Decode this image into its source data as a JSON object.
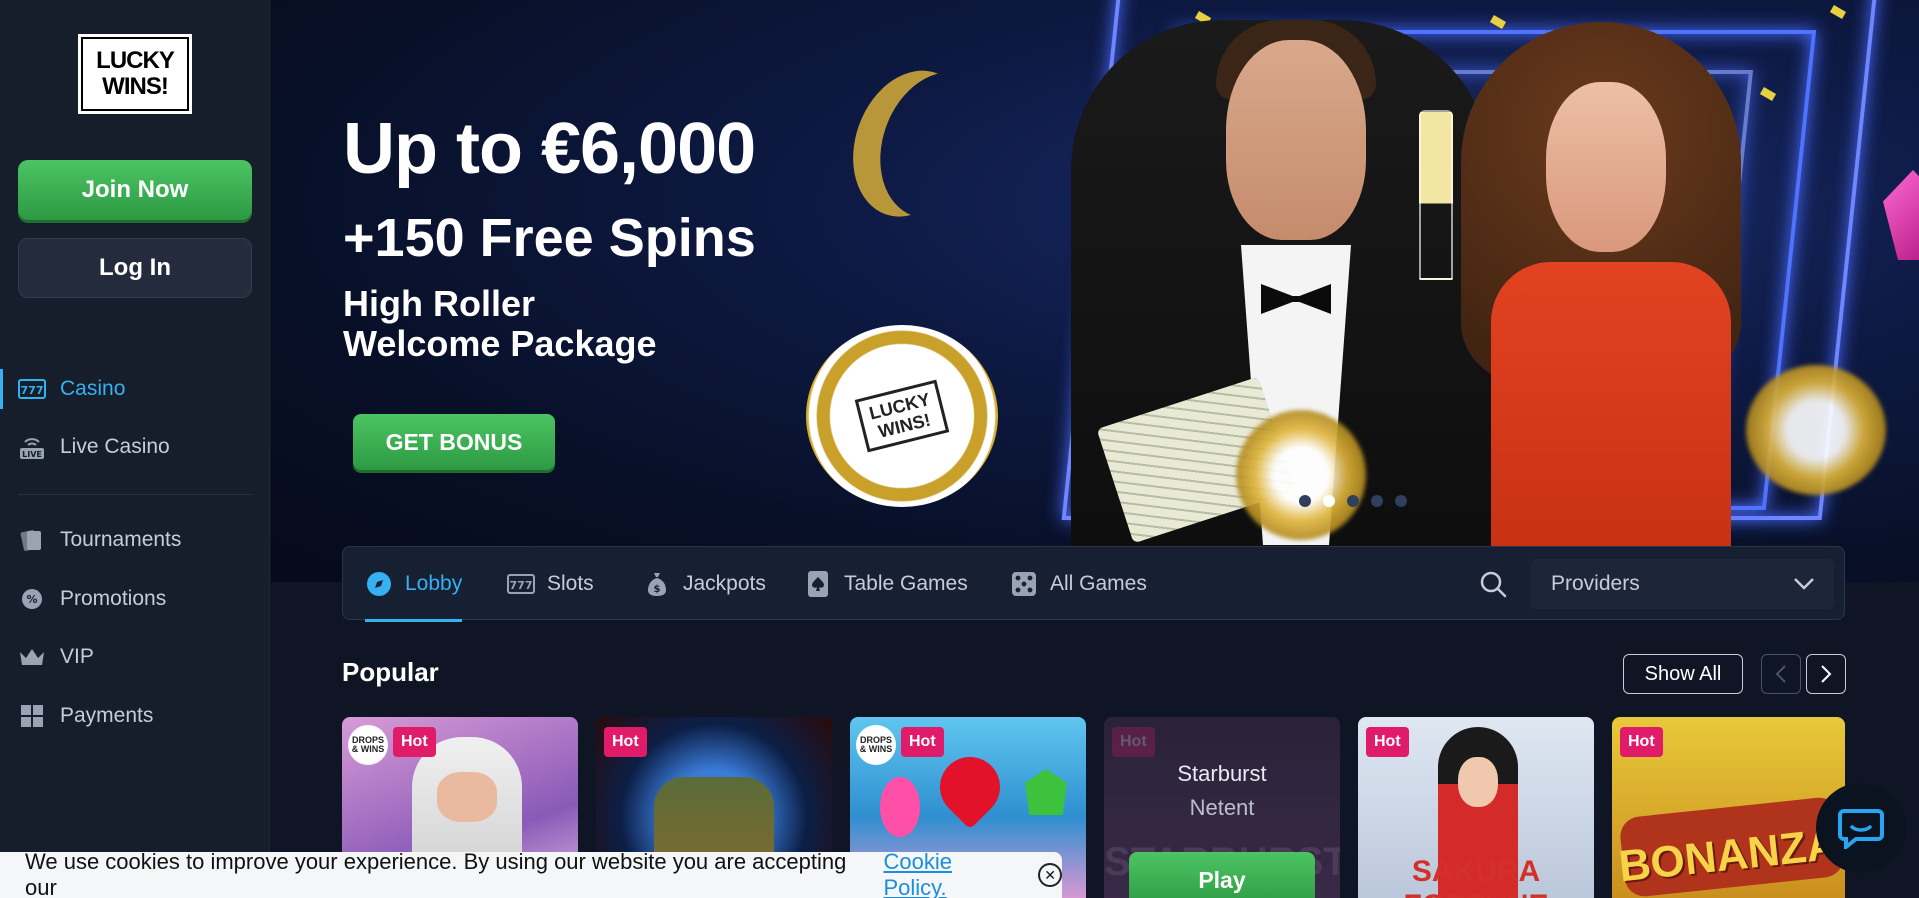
{
  "brand": {
    "logo_line1": "LUCKY",
    "logo_line2": "WINS!"
  },
  "auth": {
    "join_label": "Join Now",
    "login_label": "Log In"
  },
  "sidebar": {
    "items": [
      {
        "label": "Casino",
        "icon": "slot-777-icon",
        "active": true
      },
      {
        "label": "Live Casino",
        "icon": "live-icon",
        "active": false
      },
      {
        "label": "Tournaments",
        "icon": "cards-icon",
        "active": false
      },
      {
        "label": "Promotions",
        "icon": "gear-badge-icon",
        "active": false
      },
      {
        "label": "VIP",
        "icon": "crown-icon",
        "active": false
      },
      {
        "label": "Payments",
        "icon": "grid-icon",
        "active": false
      }
    ]
  },
  "hero": {
    "title": "Up to €6,000",
    "subtitle": "+150 Free Spins",
    "desc_line1": "High Roller",
    "desc_line2": "Welcome Package",
    "cta": "GET BONUS",
    "chip_line1": "LUCKY",
    "chip_line2": "WINS!",
    "slides_total": 5,
    "slide_active": 2
  },
  "tabs": {
    "items": [
      {
        "label": "Lobby",
        "icon": "compass-icon",
        "active": true
      },
      {
        "label": "Slots",
        "icon": "slot-777-icon",
        "active": false
      },
      {
        "label": "Jackpots",
        "icon": "money-bag-icon",
        "active": false
      },
      {
        "label": "Table Games",
        "icon": "card-spade-icon",
        "active": false
      },
      {
        "label": "All Games",
        "icon": "dice-icon",
        "active": false
      }
    ],
    "providers_label": "Providers"
  },
  "popular": {
    "title": "Popular",
    "show_all": "Show All",
    "cards": [
      {
        "badge": "Hot",
        "drops": true
      },
      {
        "badge": "Hot",
        "drops": false
      },
      {
        "badge": "Hot",
        "drops": true
      },
      {
        "badge": "Hot",
        "name": "Starburst",
        "provider": "Netent",
        "play": "Play",
        "art": "STARBURST",
        "hover": true
      },
      {
        "badge": "Hot",
        "drops": false,
        "art": "SAKURA FORTUNE"
      },
      {
        "badge": "Hot",
        "drops": false,
        "art": "BONANZA"
      }
    ],
    "drops_text": "DROPS & WINS"
  },
  "cookie": {
    "text": "We use cookies to improve your experience. By using our website you are accepting our",
    "link": "Cookie Policy."
  },
  "colors": {
    "accent": "#35b1f2",
    "green": "#3db354",
    "hot": "#e01b6a"
  }
}
